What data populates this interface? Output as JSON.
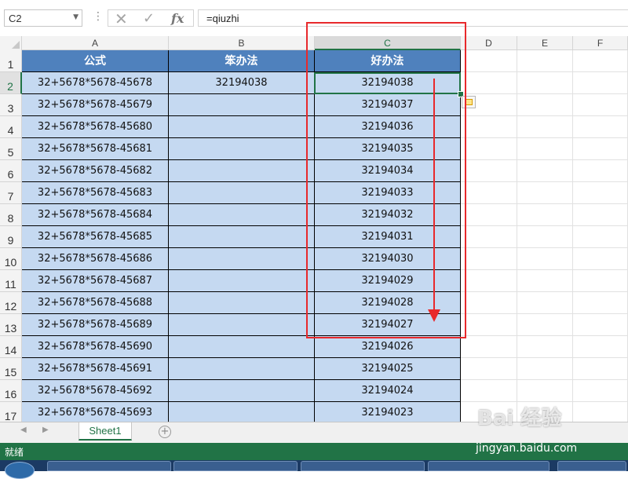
{
  "formula_bar": {
    "name_box": "C2",
    "cancel_icon": "✕",
    "enter_icon": "✓",
    "fx_label": "fx",
    "formula": "=qiuzhi"
  },
  "columns": [
    "A",
    "B",
    "C",
    "D",
    "E",
    "F"
  ],
  "header_row": {
    "a": "公式",
    "b": "笨办法",
    "c": "好办法"
  },
  "rows": [
    {
      "num": "1"
    },
    {
      "num": "2",
      "a": "32+5678*5678-45678",
      "b": "32194038",
      "c": "32194038"
    },
    {
      "num": "3",
      "a": "32+5678*5678-45679",
      "b": "",
      "c": "32194037"
    },
    {
      "num": "4",
      "a": "32+5678*5678-45680",
      "b": "",
      "c": "32194036"
    },
    {
      "num": "5",
      "a": "32+5678*5678-45681",
      "b": "",
      "c": "32194035"
    },
    {
      "num": "6",
      "a": "32+5678*5678-45682",
      "b": "",
      "c": "32194034"
    },
    {
      "num": "7",
      "a": "32+5678*5678-45683",
      "b": "",
      "c": "32194033"
    },
    {
      "num": "8",
      "a": "32+5678*5678-45684",
      "b": "",
      "c": "32194032"
    },
    {
      "num": "9",
      "a": "32+5678*5678-45685",
      "b": "",
      "c": "32194031"
    },
    {
      "num": "10",
      "a": "32+5678*5678-45686",
      "b": "",
      "c": "32194030"
    },
    {
      "num": "11",
      "a": "32+5678*5678-45687",
      "b": "",
      "c": "32194029"
    },
    {
      "num": "12",
      "a": "32+5678*5678-45688",
      "b": "",
      "c": "32194028"
    },
    {
      "num": "13",
      "a": "32+5678*5678-45689",
      "b": "",
      "c": "32194027"
    },
    {
      "num": "14",
      "a": "32+5678*5678-45690",
      "b": "",
      "c": "32194026"
    },
    {
      "num": "15",
      "a": "32+5678*5678-45691",
      "b": "",
      "c": "32194025"
    },
    {
      "num": "16",
      "a": "32+5678*5678-45692",
      "b": "",
      "c": "32194024"
    },
    {
      "num": "17",
      "a": "32+5678*5678-45693",
      "b": "",
      "c": "32194023"
    }
  ],
  "sheet_tabs": [
    "Sheet1"
  ],
  "add_sheet_icon": "+",
  "status_text": "就绪",
  "watermark_logo": "Bai 经验",
  "watermark_url": "jingyan.baidu.com",
  "colors": {
    "header_blue": "#4f81bd",
    "cell_blue": "#c5d9f1",
    "excel_green": "#217346",
    "annotation_red": "#e8292c"
  }
}
